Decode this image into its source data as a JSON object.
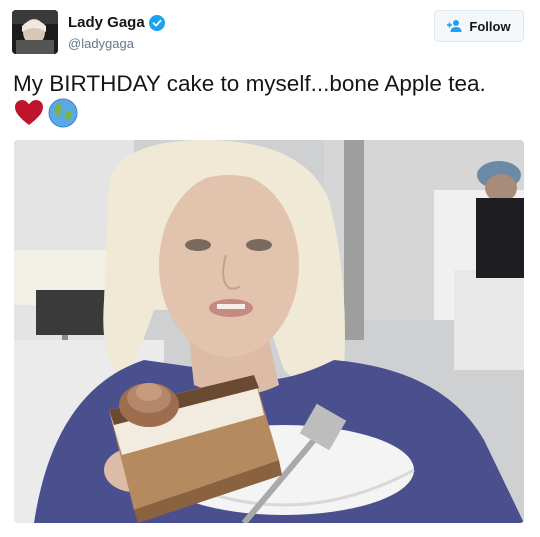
{
  "user": {
    "name": "Lady Gaga",
    "handle": "@ladygaga",
    "verified": true
  },
  "follow_button": {
    "label": "Follow",
    "icon": "add-user-icon"
  },
  "tweet": {
    "text": "My BIRTHDAY cake to myself...bone Apple tea.",
    "emojis": [
      "red-heart-emoji",
      "globe-emoji"
    ]
  },
  "media": {
    "type": "photo"
  },
  "colors": {
    "verified": "#1da1f2",
    "handle": "#657786",
    "follow_border": "#e1e8ed",
    "follow_bg": "#f5f8fa",
    "heart": "#c0142c",
    "sweater": "#4a4f8e"
  }
}
